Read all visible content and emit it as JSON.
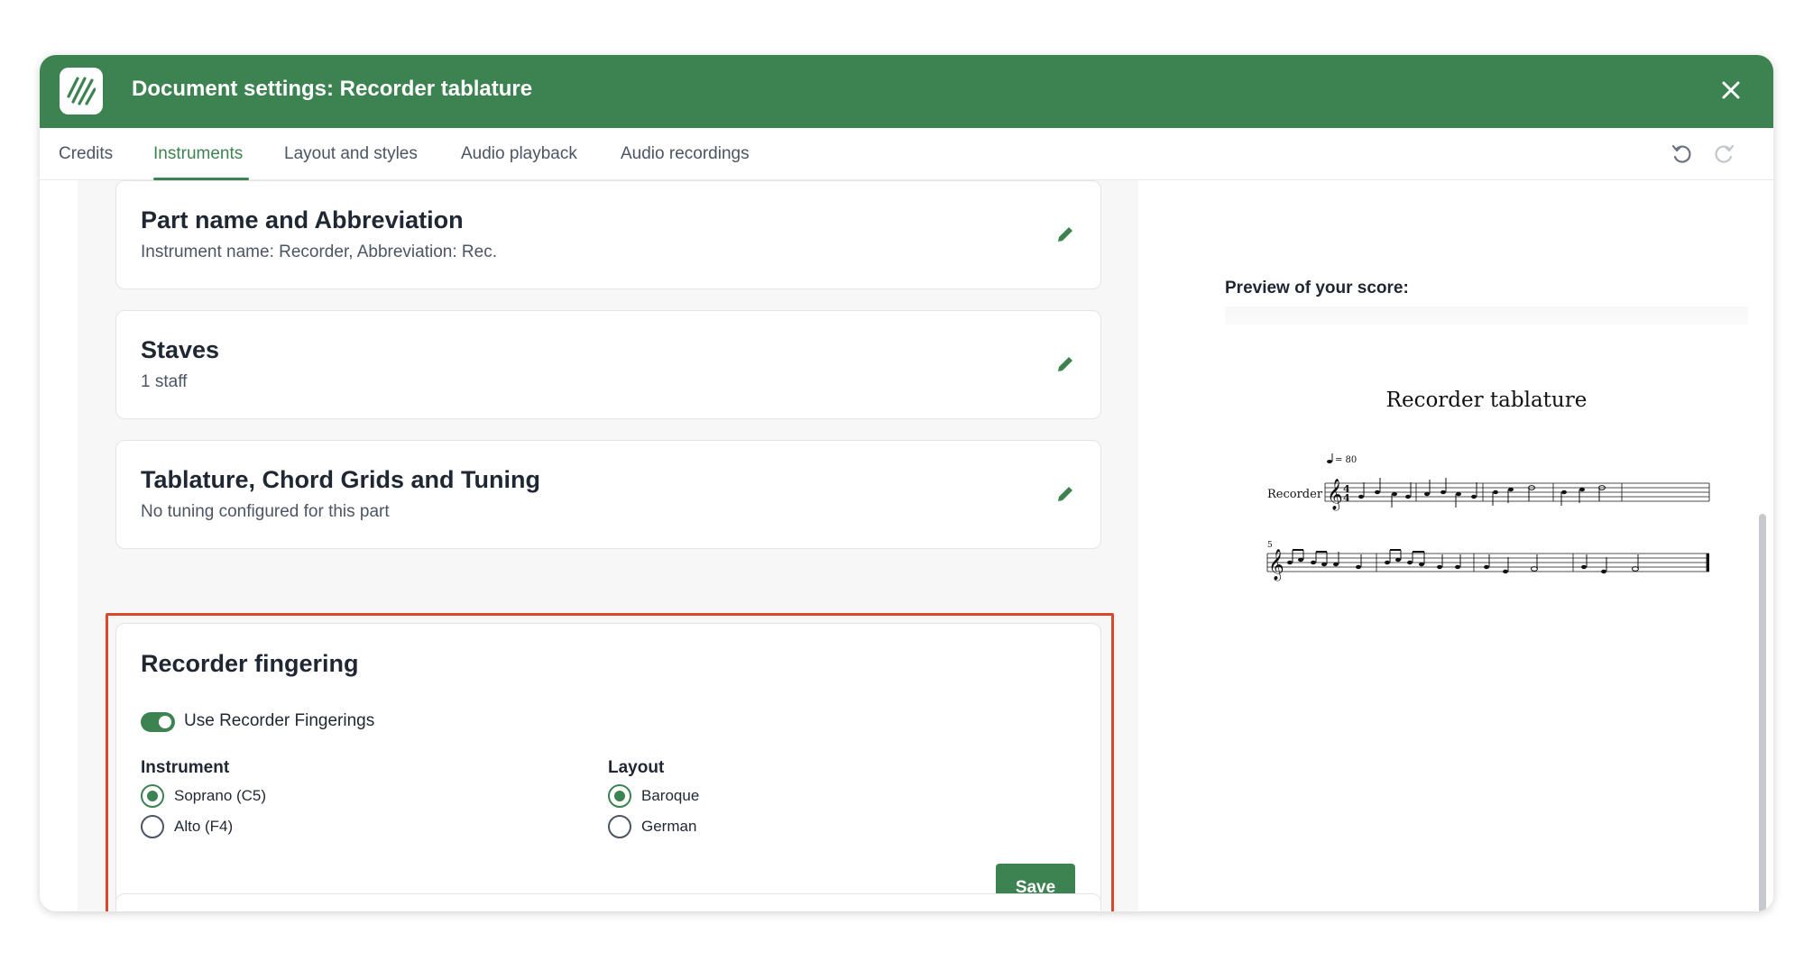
{
  "window": {
    "title": "Document settings: Recorder tablature"
  },
  "tabs": [
    {
      "label": "Credits"
    },
    {
      "label": "Instruments"
    },
    {
      "label": "Layout and styles"
    },
    {
      "label": "Audio playback"
    },
    {
      "label": "Audio recordings"
    }
  ],
  "active_tab": "Instruments",
  "cards": {
    "part_name": {
      "title": "Part name and Abbreviation",
      "subtitle": "Instrument name: Recorder, Abbreviation: Rec."
    },
    "staves": {
      "title": "Staves",
      "subtitle": "1 staff"
    },
    "tablature": {
      "title": "Tablature, Chord Grids and Tuning",
      "subtitle": "No tuning configured for this part"
    },
    "recorder_fingering": {
      "title": "Recorder fingering",
      "toggle_label": "Use Recorder Fingerings",
      "toggle_on": true,
      "instrument": {
        "label": "Instrument",
        "options": [
          "Soprano (C5)",
          "Alto (F4)"
        ],
        "selected": "Soprano (C5)"
      },
      "layout": {
        "label": "Layout",
        "options": [
          "Baroque",
          "German"
        ],
        "selected": "Baroque"
      },
      "save_label": "Save"
    }
  },
  "preview": {
    "label": "Preview of your score:",
    "score_title": "Recorder tablature",
    "instrument_label": "Recorder",
    "tempo": "= 80",
    "measure_number": "5"
  },
  "colors": {
    "brand": "#3d8351",
    "highlight": "#d9482b"
  },
  "icons": [
    "logo-icon",
    "close-icon",
    "undo-icon",
    "redo-icon",
    "pencil-icon"
  ]
}
